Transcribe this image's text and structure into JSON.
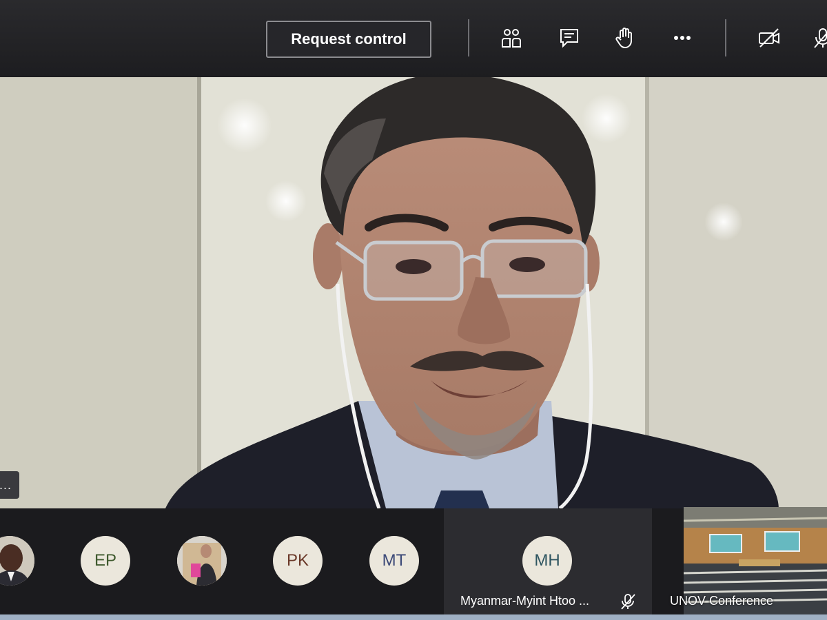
{
  "toolbar": {
    "request_control_label": "Request control",
    "icons": [
      "participants-icon",
      "chat-icon",
      "raise-hand-icon",
      "more-options-icon",
      "camera-off-icon",
      "mic-off-icon"
    ]
  },
  "participants": [
    {
      "initials": "",
      "kind": "photo"
    },
    {
      "initials": "EP",
      "kind": "initials"
    },
    {
      "initials": "",
      "kind": "photo"
    },
    {
      "initials": "PK",
      "kind": "initials"
    },
    {
      "initials": "MT",
      "kind": "initials"
    },
    {
      "initials": "MH",
      "kind": "initials",
      "name": "Myanmar-Myint Htoo ...",
      "muted": true
    }
  ],
  "room": {
    "label": "UNOV Conference"
  },
  "more_pill": "..."
}
